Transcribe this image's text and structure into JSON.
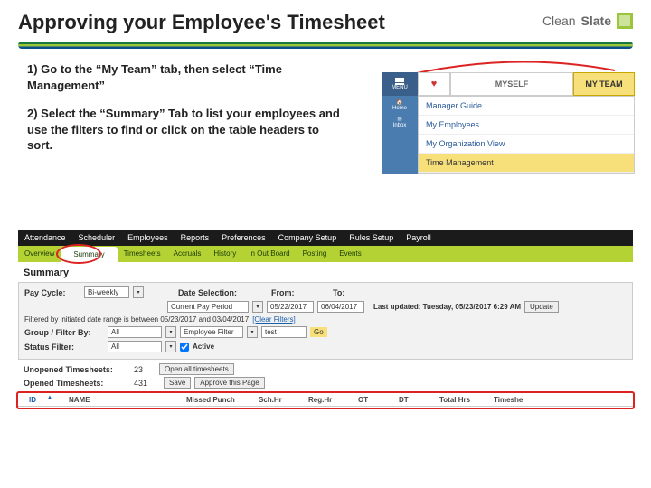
{
  "title": "Approving your Employee's Timesheet",
  "brand": {
    "name_a": "Clean",
    "name_b": "Slate"
  },
  "steps": {
    "s1": "1) Go to the “My Team” tab, then select “Time Management”",
    "s2": "2) Select the “Summary” Tab to list your employees and use the filters to find or click on the table headers to sort."
  },
  "nav": {
    "menu": "MENU",
    "heart": "♥",
    "myself": "MYSELF",
    "myteam": "MY TEAM",
    "home": "Home",
    "inbox": "Inbox",
    "links": [
      "Manager Guide",
      "My Employees",
      "My Organization View",
      "Time Management"
    ]
  },
  "app": {
    "black_tabs": [
      "Attendance",
      "Scheduler",
      "Employees",
      "Reports",
      "Preferences",
      "Company Setup",
      "Rules Setup",
      "Payroll"
    ],
    "green_tabs": [
      "Overview",
      "Summary",
      "Timesheets",
      "Accruals",
      "History",
      "In Out Board",
      "Posting",
      "Events"
    ],
    "section_heading": "Summary",
    "row1": {
      "pay_cycle_lbl": "Pay Cycle:",
      "pay_cycle_val": "Bi-weekly",
      "date_sel_lbl": "Date Selection:",
      "date_sel_val": "Current Pay Period",
      "from_lbl": "From:",
      "from_val": "05/22/2017",
      "to_lbl": "To:",
      "to_val": "06/04/2017",
      "last_upd": "Last updated: Tuesday, 05/23/2017 6:29 AM",
      "update_btn": "Update"
    },
    "filter_line": {
      "prefix": "Filtered by initiated date range is between 05/23/2017 and 03/04/2017 ",
      "clear": "[Clear Filters]"
    },
    "group_row": {
      "lbl": "Group / Filter By:",
      "all": "All",
      "emp_filter": "Employee Filter",
      "test": "test",
      "go": "Go"
    },
    "status_row": {
      "lbl": "Status Filter:",
      "all": "All",
      "active": "Active"
    },
    "counts": {
      "unopened_lbl": "Unopened Timesheets:",
      "unopened_val": "23",
      "unopened_link": "Open all timesheets",
      "opened_lbl": "Opened Timesheets:",
      "opened_val": "431",
      "save": "Save",
      "approve": "Approve this Page"
    },
    "thead": {
      "id": "ID",
      "name": "NAME",
      "missed": "Missed Punch",
      "sch": "Sch.Hr",
      "reg": "Reg.Hr",
      "ot": "OT",
      "dt": "DT",
      "total": "Total Hrs",
      "ts": "Timeshe"
    }
  }
}
